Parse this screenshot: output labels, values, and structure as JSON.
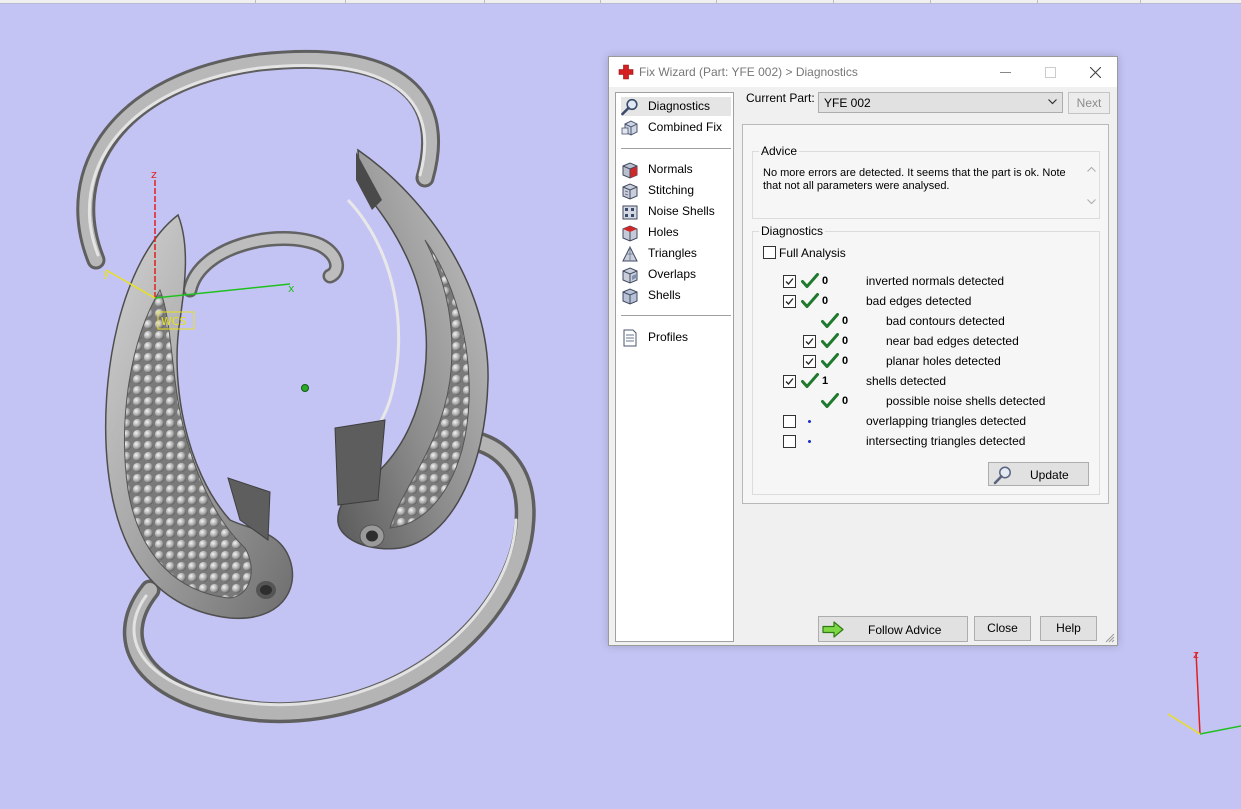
{
  "viewport": {
    "background": "#c4c4f4",
    "model_axis_labels": {
      "z": "z",
      "y": "y",
      "x": "x"
    },
    "wcs_label": "WCS",
    "corner_axis_label": "z"
  },
  "dialog": {
    "title": "Fix Wizard (Part: YFE 002) > Diagnostics",
    "app_icon": "red-cross-icon",
    "nav": {
      "top_items": [
        {
          "label": "Diagnostics",
          "icon": "magnifier-icon",
          "selected": true
        },
        {
          "label": "Combined Fix",
          "icon": "cube-stack-icon",
          "selected": false
        }
      ],
      "tool_items": [
        {
          "label": "Normals",
          "icon": "normals-cube-icon"
        },
        {
          "label": "Stitching",
          "icon": "stitching-cube-icon"
        },
        {
          "label": "Noise Shells",
          "icon": "noise-shells-icon"
        },
        {
          "label": "Holes",
          "icon": "holes-cube-icon"
        },
        {
          "label": "Triangles",
          "icon": "triangles-icon"
        },
        {
          "label": "Overlaps",
          "icon": "overlaps-cube-icon"
        },
        {
          "label": "Shells",
          "icon": "shells-cube-icon"
        }
      ],
      "bottom_items": [
        {
          "label": "Profiles",
          "icon": "document-icon"
        }
      ]
    },
    "current_part": {
      "label": "Current Part:",
      "value": "YFE 002"
    },
    "next_label": "Next",
    "advice": {
      "title": "Advice",
      "text": "No more errors are detected. It seems that the part is ok. Note that not all parameters were analysed."
    },
    "diagnostics": {
      "title": "Diagnostics",
      "full_analysis_label": "Full Analysis",
      "full_analysis_checked": false,
      "rows": [
        {
          "checkbox": true,
          "checked": true,
          "status": "ok",
          "count": "0",
          "label": "inverted normals detected",
          "indent": 0
        },
        {
          "checkbox": true,
          "checked": true,
          "status": "ok",
          "count": "0",
          "label": "bad edges detected",
          "indent": 0
        },
        {
          "checkbox": false,
          "checked": false,
          "status": "ok",
          "count": "0",
          "label": "bad contours detected",
          "indent": 1
        },
        {
          "checkbox": true,
          "checked": true,
          "status": "ok",
          "count": "0",
          "label": "near bad edges detected",
          "indent": 1
        },
        {
          "checkbox": true,
          "checked": true,
          "status": "ok",
          "count": "0",
          "label": "planar holes detected",
          "indent": 1
        },
        {
          "checkbox": true,
          "checked": true,
          "status": "ok",
          "count": "1",
          "label": "shells detected",
          "indent": 0
        },
        {
          "checkbox": false,
          "checked": false,
          "status": "ok",
          "count": "0",
          "label": "possible noise shells detected",
          "indent": 1
        },
        {
          "checkbox": true,
          "checked": false,
          "status": "pending",
          "count": "",
          "label": "overlapping triangles detected",
          "indent": 0
        },
        {
          "checkbox": true,
          "checked": false,
          "status": "pending",
          "count": "",
          "label": "intersecting triangles detected",
          "indent": 0
        }
      ],
      "update_label": "Update"
    },
    "buttons": {
      "follow_advice": "Follow Advice",
      "close": "Close",
      "help": "Help"
    },
    "colors": {
      "check_green": "#1f7a2e",
      "pending_dot": "#2030c8",
      "nav_selected": "#e5e5e5"
    }
  }
}
